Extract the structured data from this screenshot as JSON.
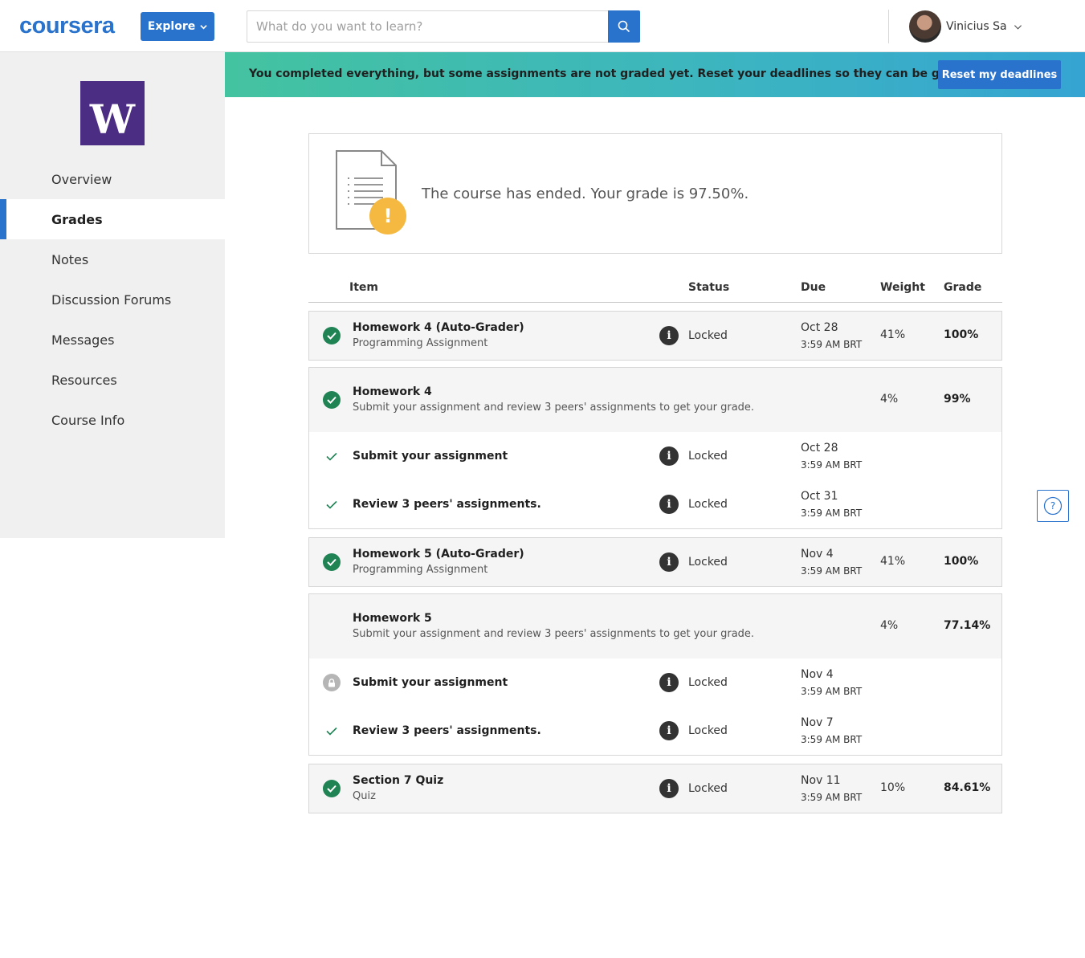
{
  "header": {
    "logo": "coursera",
    "explore_label": "Explore",
    "search_placeholder": "What do you want to learn?",
    "user_name": "Vinicius Sa"
  },
  "banner": {
    "message": "You completed everything, but some assignments are not graded yet. Reset your deadlines so they can be graded!",
    "button_label": "Reset my deadlines"
  },
  "sidebar": {
    "university_logo_letter": "W",
    "items": [
      {
        "label": "Overview"
      },
      {
        "label": "Grades"
      },
      {
        "label": "Notes"
      },
      {
        "label": "Discussion Forums"
      },
      {
        "label": "Messages"
      },
      {
        "label": "Resources"
      },
      {
        "label": "Course Info"
      }
    ]
  },
  "summary": {
    "text": "The course has ended. Your grade is 97.50%."
  },
  "table": {
    "columns": {
      "item": "Item",
      "status": "Status",
      "due": "Due",
      "weight": "Weight",
      "grade": "Grade"
    },
    "hw4_auto": {
      "title": "Homework 4 (Auto-Grader)",
      "type": "Programming Assignment",
      "status": "Locked",
      "due_date": "Oct 28",
      "due_time": "3:59 AM BRT",
      "weight": "41%",
      "grade": "100%"
    },
    "hw4": {
      "title": "Homework 4",
      "type": "Submit your assignment and review 3 peers' assignments to get your grade.",
      "weight": "4%",
      "grade": "99%",
      "sub1": {
        "title": "Submit your assignment",
        "status": "Locked",
        "due_date": "Oct 28",
        "due_time": "3:59 AM BRT"
      },
      "sub2": {
        "title": "Review 3 peers' assignments.",
        "status": "Locked",
        "due_date": "Oct 31",
        "due_time": "3:59 AM BRT"
      }
    },
    "hw5_auto": {
      "title": "Homework 5 (Auto-Grader)",
      "type": "Programming Assignment",
      "status": "Locked",
      "due_date": "Nov 4",
      "due_time": "3:59 AM BRT",
      "weight": "41%",
      "grade": "100%"
    },
    "hw5": {
      "title": "Homework 5",
      "type": "Submit your assignment and review 3 peers' assignments to get your grade.",
      "weight": "4%",
      "grade": "77.14%",
      "sub1": {
        "title": "Submit your assignment",
        "status": "Locked",
        "due_date": "Nov 4",
        "due_time": "3:59 AM BRT"
      },
      "sub2": {
        "title": "Review 3 peers' assignments.",
        "status": "Locked",
        "due_date": "Nov 7",
        "due_time": "3:59 AM BRT"
      }
    },
    "quiz7": {
      "title": "Section 7 Quiz",
      "type": "Quiz",
      "status": "Locked",
      "due_date": "Nov 11",
      "due_time": "3:59 AM BRT",
      "weight": "10%",
      "grade": "84.61%"
    }
  },
  "colors": {
    "brand_blue": "#2a73cc",
    "success_green": "#1f8354",
    "uw_purple": "#4b2e83",
    "warning_yellow": "#f5b942"
  }
}
